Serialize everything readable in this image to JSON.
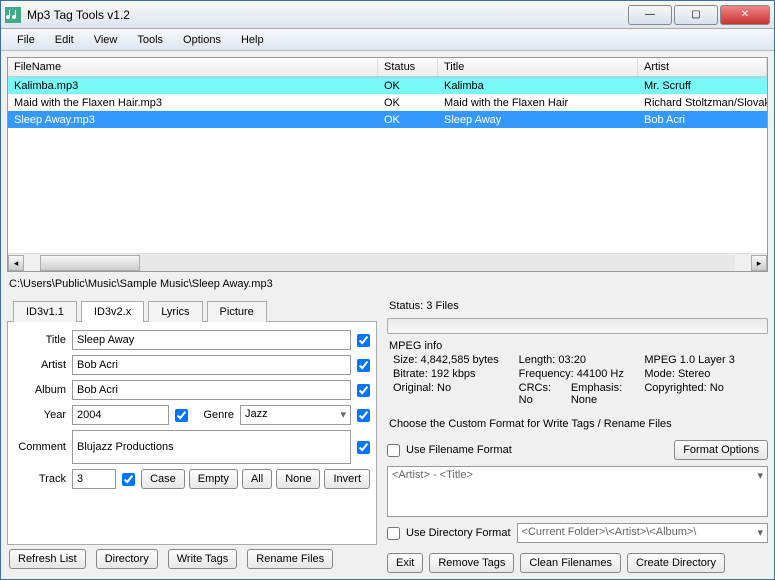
{
  "window": {
    "title": "Mp3 Tag Tools v1.2"
  },
  "menu": [
    "File",
    "Edit",
    "View",
    "Tools",
    "Options",
    "Help"
  ],
  "columns": {
    "filename": "FileName",
    "status": "Status",
    "title": "Title",
    "artist": "Artist"
  },
  "files": [
    {
      "filename": "Kalimba.mp3",
      "status": "OK",
      "title": "Kalimba",
      "artist": "Mr. Scruff",
      "state": "hl"
    },
    {
      "filename": "Maid with the Flaxen Hair.mp3",
      "status": "OK",
      "title": "Maid with the Flaxen Hair",
      "artist": "Richard Stoltzman/Slovak",
      "state": ""
    },
    {
      "filename": "Sleep Away.mp3",
      "status": "OK",
      "title": "Sleep Away",
      "artist": "Bob Acri",
      "state": "sel"
    }
  ],
  "path": "C:\\Users\\Public\\Music\\Sample Music\\Sleep Away.mp3",
  "tabs": {
    "id3v1": "ID3v1.1",
    "id3v2": "ID3v2.x",
    "lyrics": "Lyrics",
    "picture": "Picture"
  },
  "form": {
    "labels": {
      "title": "Title",
      "artist": "Artist",
      "album": "Album",
      "year": "Year",
      "genre": "Genre",
      "comment": "Comment",
      "track": "Track"
    },
    "values": {
      "title": "Sleep Away",
      "artist": "Bob Acri",
      "album": "Bob Acri",
      "year": "2004",
      "genre": "Jazz",
      "comment": "Blujazz Productions",
      "track": "3"
    }
  },
  "tagBtns": {
    "case": "Case",
    "empty": "Empty",
    "all": "All",
    "none": "None",
    "invert": "Invert"
  },
  "bottomLeft": {
    "refresh": "Refresh List",
    "directory": "Directory",
    "write": "Write Tags",
    "rename": "Rename Files"
  },
  "status": {
    "label": "Status: 3 Files"
  },
  "mpeg": {
    "title": "MPEG info",
    "size": "Size: 4,842,585 bytes",
    "length": "Length:  03:20",
    "version": "MPEG 1.0 Layer 3",
    "bitrate": "Bitrate: 192 kbps",
    "frequency": "Frequency: 44100 Hz",
    "mode": "Mode: Stereo",
    "original": "Original: No",
    "crcs": "CRCs: No",
    "emphasis": "Emphasis: None",
    "copyright": "Copyrighted: No"
  },
  "custom": {
    "heading": "Choose the Custom Format for Write Tags / Rename Files",
    "useFilename": "Use Filename Format",
    "formatOptions": "Format Options",
    "filenameFmt": "<Artist> - <Title>",
    "useDirectory": "Use Directory Format",
    "directoryFmt": "<Current Folder>\\<Artist>\\<Album>\\"
  },
  "bottomRight": {
    "exit": "Exit",
    "remove": "Remove Tags",
    "clean": "Clean Filenames",
    "create": "Create Directory"
  }
}
